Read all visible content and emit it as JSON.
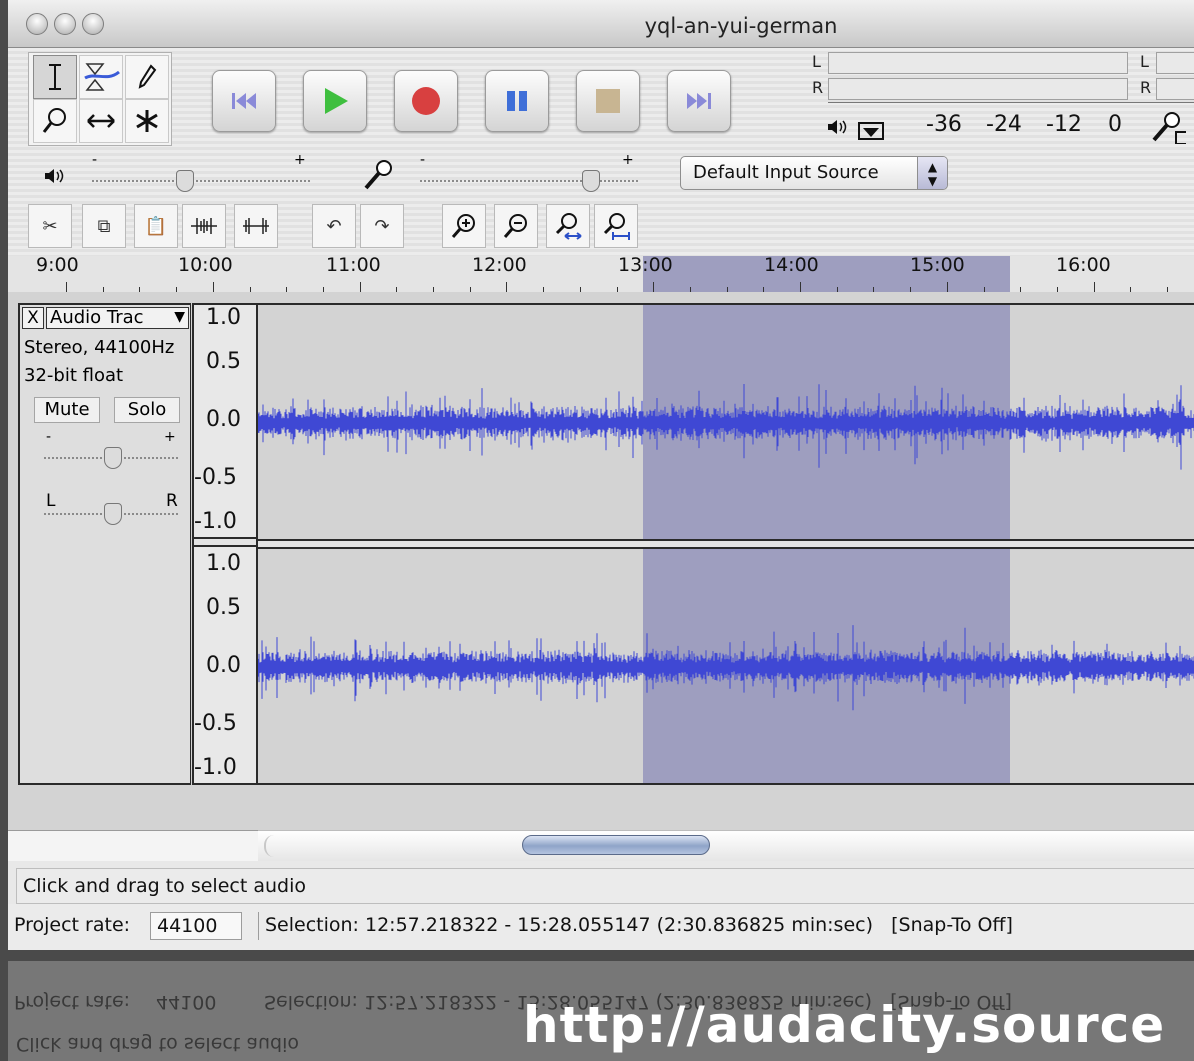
{
  "window": {
    "title": "yql-an-yui-german"
  },
  "meters": {
    "playback_left": "L",
    "playback_right": "R",
    "record_left": "L",
    "record_right": "R",
    "scale": [
      "-36",
      "-24",
      "-12",
      "0"
    ]
  },
  "mixer": {
    "output_minus": "-",
    "output_plus": "+",
    "input_minus": "-",
    "input_plus": "+",
    "input_source": "Default Input Source"
  },
  "timeline": {
    "labels": [
      "9:00",
      "10:00",
      "11:00",
      "12:00",
      "13:00",
      "14:00",
      "15:00",
      "16:00"
    ]
  },
  "track": {
    "name": "Audio Trac",
    "close_glyph": "X",
    "format_line1": "Stereo, 44100Hz",
    "format_line2": "32-bit float",
    "mute_label": "Mute",
    "solo_label": "Solo",
    "gain_minus": "-",
    "gain_plus": "+",
    "pan_left": "L",
    "pan_right": "R",
    "channel_scale": [
      "1.0",
      "0.5",
      "0.0",
      "-0.5",
      "-1.0"
    ],
    "waveform_color": "#3f48d4",
    "selection_color": "#9e9ebf"
  },
  "status": {
    "hint": "Click and drag to select audio",
    "project_rate_label": "Project rate:",
    "project_rate_value": "44100",
    "selection_text": "Selection: 12:57.218322 - 15:28.055147 (2:30.836825 min:sec)   [Snap-To Off]"
  },
  "footer": {
    "url_text": "http://audacity.source"
  },
  "icons": {
    "tools": [
      "selection-tool-icon",
      "envelope-tool-icon",
      "draw-tool-icon",
      "zoom-tool-icon",
      "timeshift-tool-icon",
      "multi-tool-icon"
    ],
    "transport": [
      "skip-start-icon",
      "play-icon",
      "record-icon",
      "pause-icon",
      "stop-icon",
      "skip-end-icon"
    ],
    "edit": [
      "cut-icon",
      "copy-icon",
      "paste-icon",
      "trim-icon",
      "silence-icon",
      "undo-icon",
      "redo-icon",
      "zoom-in-icon",
      "zoom-out-icon",
      "fit-selection-icon",
      "fit-project-icon"
    ]
  }
}
